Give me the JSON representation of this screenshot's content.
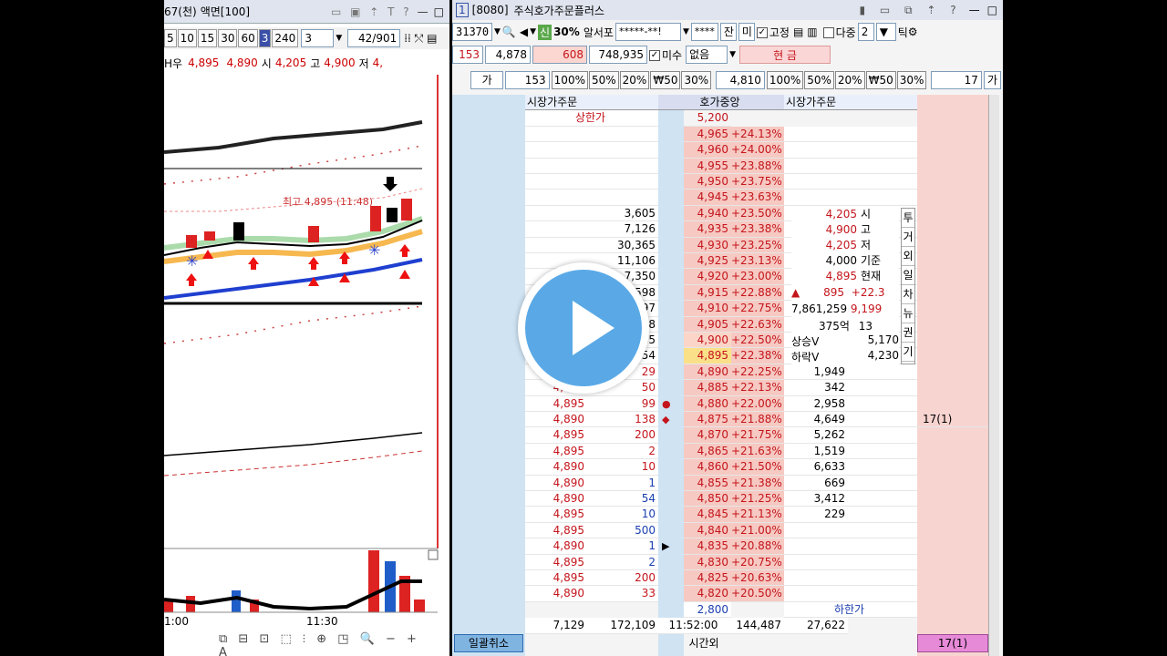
{
  "chart_window": {
    "title_code": "67(천)",
    "title_mode": "액면[100]",
    "toolbar": {
      "periods": [
        "5",
        "10",
        "15",
        "30",
        "60",
        "3",
        "240"
      ],
      "active_period": "3",
      "count_value": "3",
      "page": "42/901"
    },
    "quote": {
      "prefix": "H우",
      "current": "4,895",
      "prev": "4,890",
      "open_label": "시",
      "open": "4,205",
      "high_label": "고",
      "high": "4,900",
      "low_label": "저",
      "low": "4,"
    },
    "high_annotation": "최고 4,895 (11:48)",
    "time_labels": [
      "1:00",
      "11:30"
    ]
  },
  "order_window": {
    "title_num": "1",
    "title_code": "[8080]",
    "title_name": "주식호가주문플러스",
    "toolbar1": {
      "code": "31370",
      "credit_badge": "신",
      "margin": "30%",
      "stock_name": "알서포",
      "account": "*****-**!",
      "password": "****",
      "balance_btn": "잔",
      "unfilled_btn": "미",
      "fixed_label": "고정",
      "multi_label": "다중",
      "multi_count": "2",
      "tick_label": "틱"
    },
    "toolbar2": {
      "qty": "153",
      "price": "4,878",
      "amount_red": "608",
      "amount": "748,935",
      "unfilled_label": "미수",
      "none_label": "없음",
      "cash_label": "현 금"
    },
    "toolbar3": {
      "buy_label": "가",
      "buy_qty": "153",
      "pct_buttons_left": [
        "100%",
        "50%",
        "20%",
        "₩50",
        "30%"
      ],
      "price": "4,810",
      "pct_buttons_right": [
        "100%",
        "50%",
        "20%",
        "₩50",
        "30%"
      ],
      "sell_qty": "17",
      "sell_label": "가"
    },
    "headers": {
      "left": "시장가주문",
      "center": "호가중앙",
      "right": "시장가주문"
    },
    "upper_limit_label": "상한가",
    "upper_limit_price": "5,200",
    "ask_rows": [
      {
        "qty": "",
        "price": "4,965",
        "pct": "+24.13%"
      },
      {
        "qty": "",
        "price": "4,960",
        "pct": "+24.00%"
      },
      {
        "qty": "",
        "price": "4,955",
        "pct": "+23.88%"
      },
      {
        "qty": "",
        "price": "4,950",
        "pct": "+23.75%"
      },
      {
        "qty": "",
        "price": "4,945",
        "pct": "+23.63%"
      },
      {
        "qty": "3,605",
        "price": "4,940",
        "pct": "+23.50%"
      },
      {
        "qty": "7,126",
        "price": "4,935",
        "pct": "+23.38%"
      },
      {
        "qty": "30,365",
        "price": "4,930",
        "pct": "+23.25%"
      },
      {
        "qty": "11,106",
        "price": "4,925",
        "pct": "+23.13%"
      },
      {
        "qty": "7,350",
        "price": "4,920",
        "pct": "+23.00%"
      },
      {
        "qty": "2,598",
        "price": "4,915",
        "pct": "+22.88%"
      },
      {
        "qty": "1,597",
        "price": "4,910",
        "pct": "+22.75%"
      },
      {
        "qty": "3,108",
        "price": "4,905",
        "pct": "+22.63%"
      },
      {
        "qty": "2,135",
        "price": "4,900",
        "pct": "+22.50%"
      },
      {
        "qty": "6,354",
        "price": "4,895",
        "pct": "+22.38%"
      }
    ],
    "bid_rows": [
      {
        "price": "4,890",
        "pct": "+22.25%",
        "qty": "1,949"
      },
      {
        "price": "4,885",
        "pct": "+22.13%",
        "qty": "342"
      },
      {
        "price": "4,880",
        "pct": "+22.00%",
        "qty": "2,958"
      },
      {
        "price": "4,875",
        "pct": "+21.88%",
        "qty": "4,649"
      },
      {
        "price": "4,870",
        "pct": "+21.75%",
        "qty": "5,262"
      },
      {
        "price": "4,865",
        "pct": "+21.63%",
        "qty": "1,519"
      },
      {
        "price": "4,860",
        "pct": "+21.50%",
        "qty": "6,633"
      },
      {
        "price": "4,855",
        "pct": "+21.38%",
        "qty": "669"
      },
      {
        "price": "4,850",
        "pct": "+21.25%",
        "qty": "3,412"
      },
      {
        "price": "4,845",
        "pct": "+21.13%",
        "qty": "229"
      },
      {
        "price": "4,840",
        "pct": "+21.00%",
        "qty": ""
      },
      {
        "price": "4,835",
        "pct": "+20.88%",
        "qty": ""
      },
      {
        "price": "4,830",
        "pct": "+20.75%",
        "qty": ""
      },
      {
        "price": "4,825",
        "pct": "+20.63%",
        "qty": ""
      },
      {
        "price": "4,820",
        "pct": "+20.50%",
        "qty": ""
      }
    ],
    "trades": [
      {
        "price": "4,895",
        "vol": "29"
      },
      {
        "price": "4,890",
        "vol": "50"
      },
      {
        "price": "4,895",
        "vol": "99"
      },
      {
        "price": "4,890",
        "vol": "138"
      },
      {
        "price": "4,895",
        "vol": "200"
      },
      {
        "price": "4,895",
        "vol": "2"
      },
      {
        "price": "4,890",
        "vol": "10"
      },
      {
        "price": "4,890",
        "vol": "1"
      },
      {
        "price": "4,890",
        "vol": "54"
      },
      {
        "price": "4,895",
        "vol": "10"
      },
      {
        "price": "4,895",
        "vol": "500"
      },
      {
        "price": "4,890",
        "vol": "1"
      },
      {
        "price": "4,895",
        "vol": "2"
      },
      {
        "price": "4,895",
        "vol": "200"
      },
      {
        "price": "4,890",
        "vol": "33"
      }
    ],
    "info_panel": [
      {
        "value": "4,205",
        "label": "시"
      },
      {
        "value": "4,900",
        "label": "고"
      },
      {
        "value": "4,205",
        "label": "저"
      },
      {
        "value": "4,000",
        "label": "기준"
      },
      {
        "value": "4,895",
        "label": "현재"
      }
    ],
    "change_value": "895",
    "change_pct": "+22.3",
    "volume": "7,861,259",
    "volume_small": "9,199",
    "amount_text": "375억",
    "amount_small": "13",
    "upper_vi_label": "상승V",
    "upper_vi": "5,170",
    "lower_vi_label": "하락V",
    "lower_vi": "4,230",
    "side_tabs": [
      "투",
      "거",
      "외",
      "일",
      "차",
      "뉴",
      "권",
      "기"
    ],
    "reserved_order": "17(1)",
    "lower_limit_price": "2,800",
    "lower_limit_label": "하한가",
    "totals": {
      "left_small": "7,129",
      "ask_total": "172,109",
      "time": "11:52:00",
      "bid_total": "144,487",
      "right_small": "27,622"
    },
    "footer": {
      "cancel_all": "일괄취소",
      "after_hours": "시간외",
      "reserved": "17(1)"
    }
  }
}
